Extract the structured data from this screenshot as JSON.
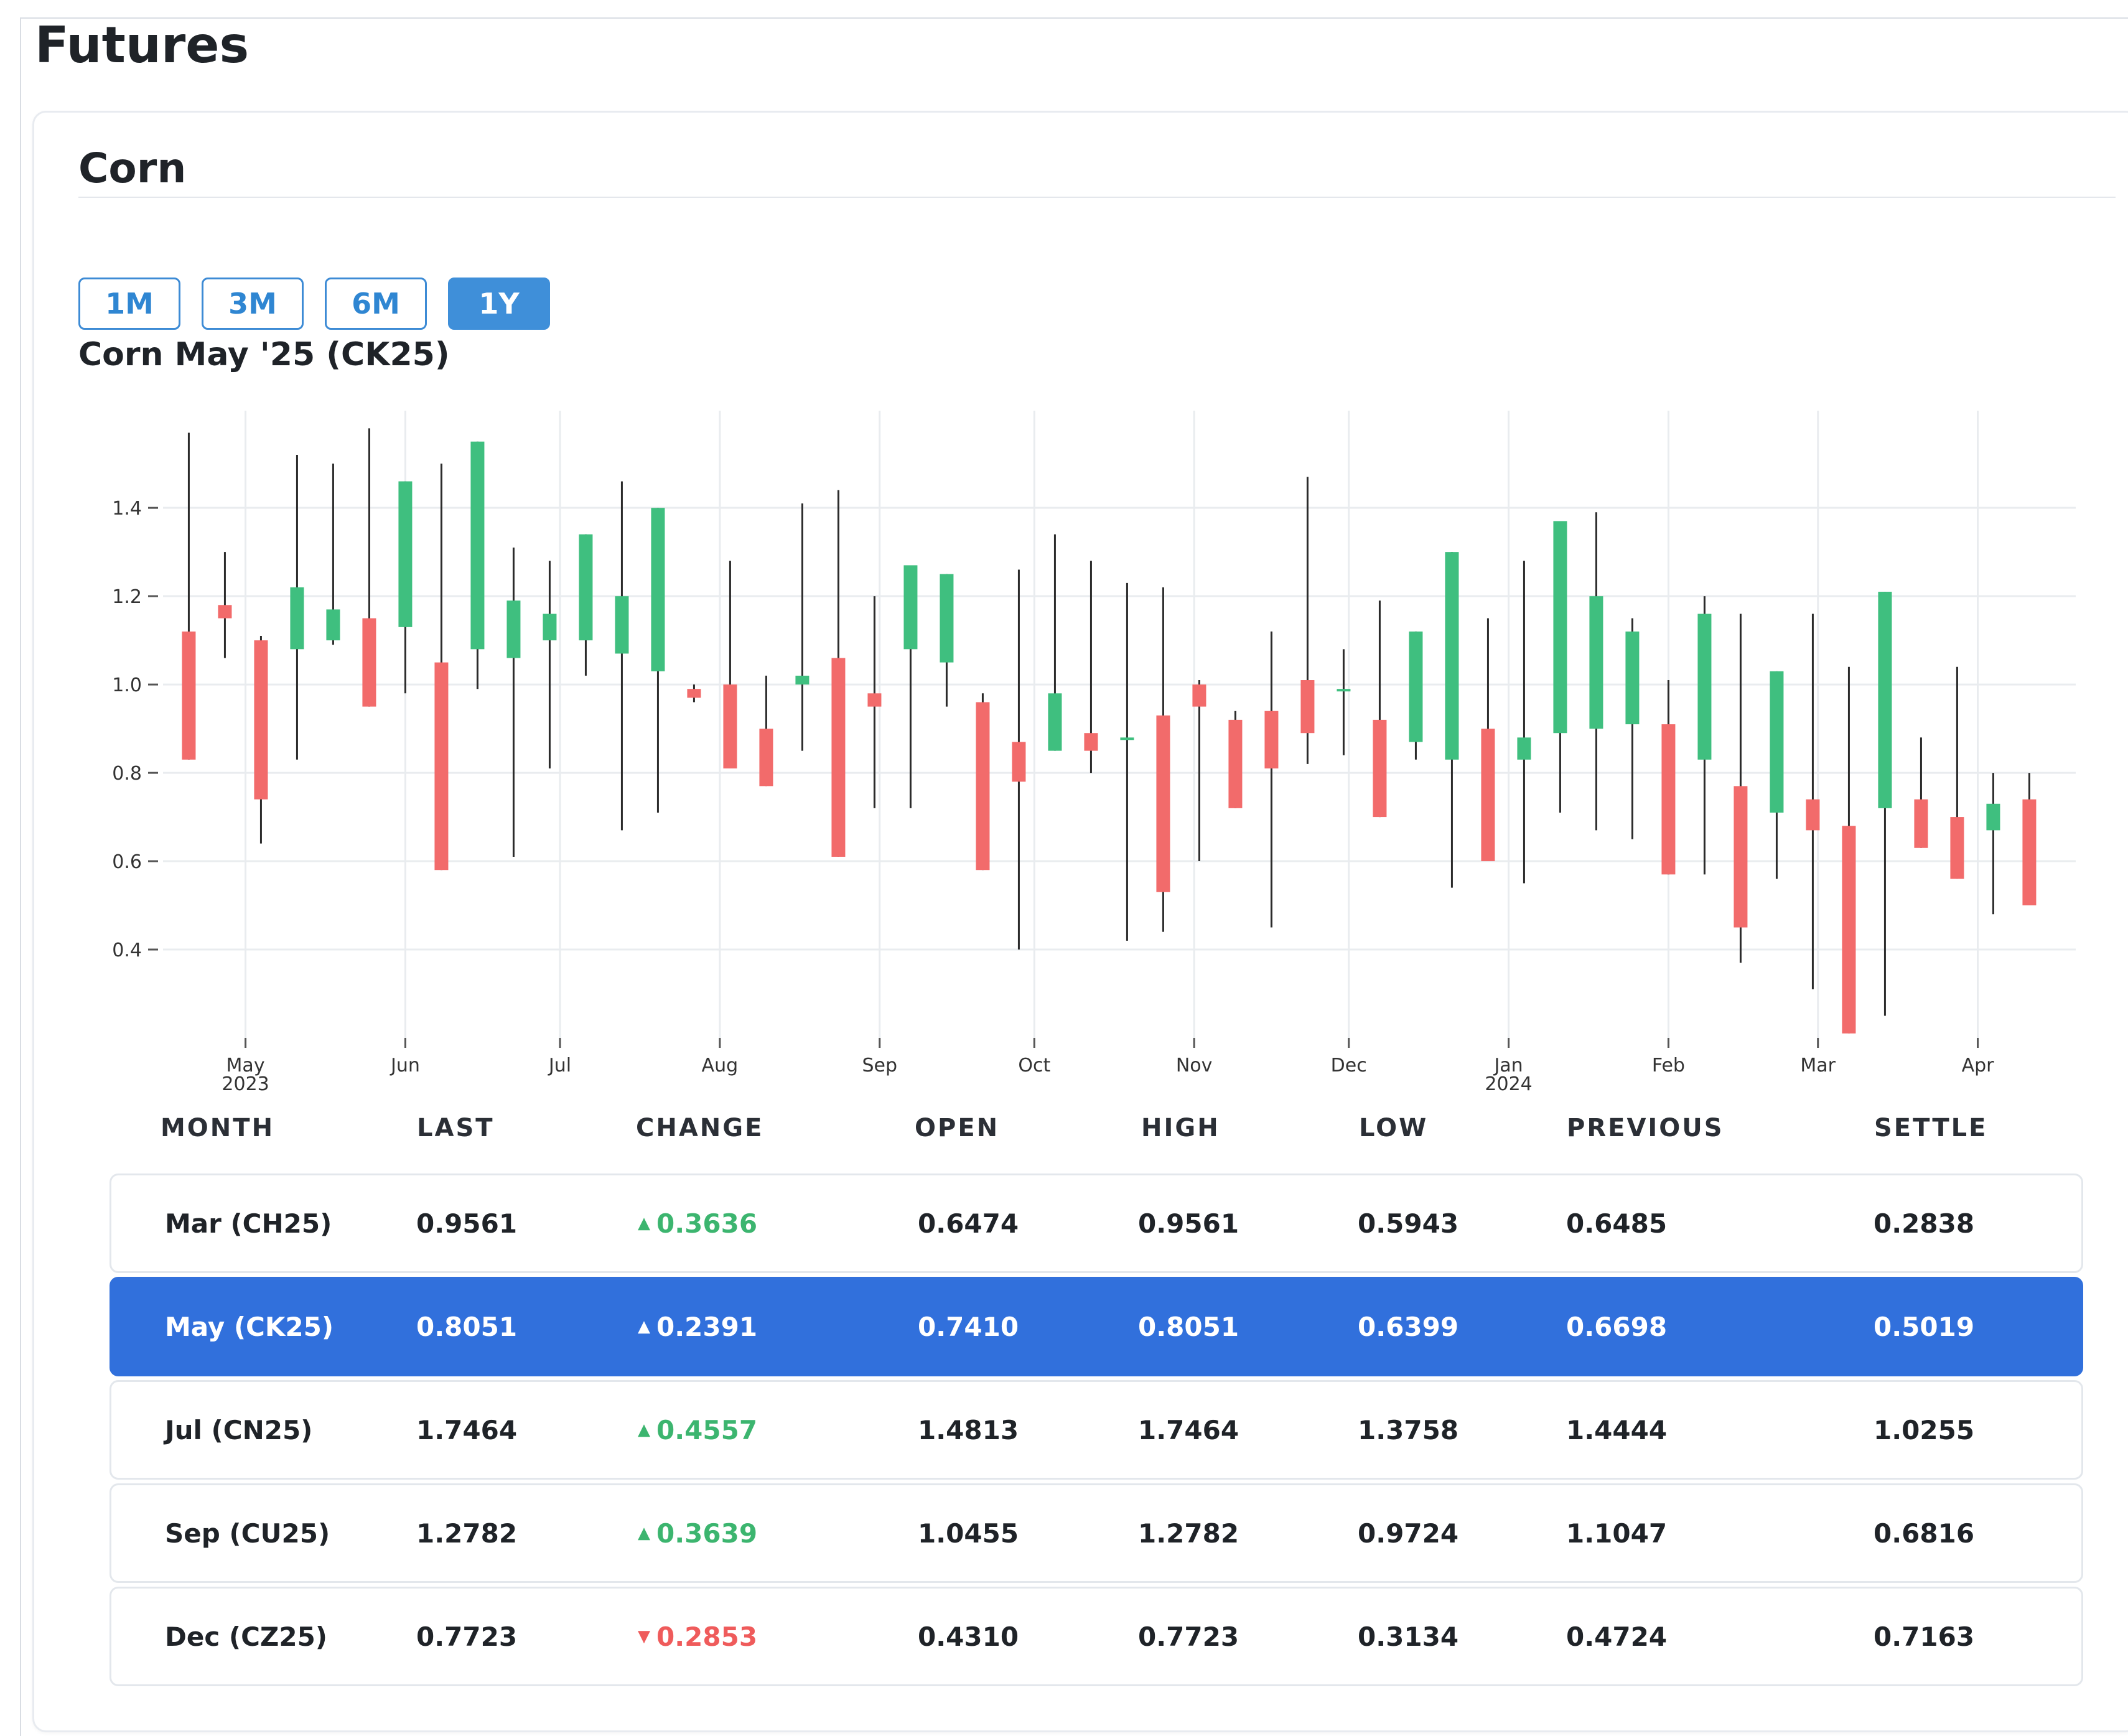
{
  "page_title": "Futures",
  "card": {
    "title": "Corn",
    "ranges": [
      {
        "label": "1M",
        "active": false
      },
      {
        "label": "3M",
        "active": false
      },
      {
        "label": "6M",
        "active": false
      },
      {
        "label": "1Y",
        "active": true
      }
    ],
    "chart_title": "Corn May '25 (CK25)"
  },
  "colors": {
    "up": "#3fbf7f",
    "down": "#f26b6b",
    "wick": "#2b2b2b",
    "grid": "#e9ecef",
    "selected_row": "#3170dc",
    "accent": "#3f8fd9"
  },
  "chart_data": {
    "type": "candlestick",
    "ylim": [
      0.2,
      1.62
    ],
    "yticks": [
      "0.4",
      "0.6",
      "0.8",
      "1.0",
      "1.2",
      "1.4"
    ],
    "x_range": [
      "2023-04-15",
      "2024-04-20"
    ],
    "xticks": [
      {
        "date": "2023-05-01",
        "label": "May",
        "sub": "2023"
      },
      {
        "date": "2023-06-01",
        "label": "Jun",
        "sub": ""
      },
      {
        "date": "2023-07-01",
        "label": "Jul",
        "sub": ""
      },
      {
        "date": "2023-08-01",
        "label": "Aug",
        "sub": ""
      },
      {
        "date": "2023-09-01",
        "label": "Sep",
        "sub": ""
      },
      {
        "date": "2023-10-01",
        "label": "Oct",
        "sub": ""
      },
      {
        "date": "2023-11-01",
        "label": "Nov",
        "sub": ""
      },
      {
        "date": "2023-12-01",
        "label": "Dec",
        "sub": ""
      },
      {
        "date": "2024-01-01",
        "label": "Jan",
        "sub": "2024"
      },
      {
        "date": "2024-02-01",
        "label": "Feb",
        "sub": ""
      },
      {
        "date": "2024-03-01",
        "label": "Mar",
        "sub": ""
      },
      {
        "date": "2024-04-01",
        "label": "Apr",
        "sub": ""
      }
    ],
    "candles": [
      {
        "date": "2023-04-20",
        "open": 1.12,
        "high": 1.57,
        "low": 0.83,
        "close": 0.83
      },
      {
        "date": "2023-04-27",
        "open": 1.18,
        "high": 1.3,
        "low": 1.06,
        "close": 1.15
      },
      {
        "date": "2023-05-04",
        "open": 1.1,
        "high": 1.11,
        "low": 0.64,
        "close": 0.74
      },
      {
        "date": "2023-05-11",
        "open": 1.08,
        "high": 1.52,
        "low": 0.83,
        "close": 1.22
      },
      {
        "date": "2023-05-18",
        "open": 1.1,
        "high": 1.5,
        "low": 1.09,
        "close": 1.17
      },
      {
        "date": "2023-05-25",
        "open": 1.15,
        "high": 1.58,
        "low": 0.95,
        "close": 0.95
      },
      {
        "date": "2023-06-01",
        "open": 1.13,
        "high": 1.46,
        "low": 0.98,
        "close": 1.46
      },
      {
        "date": "2023-06-08",
        "open": 1.05,
        "high": 1.5,
        "low": 0.58,
        "close": 0.58
      },
      {
        "date": "2023-06-15",
        "open": 1.08,
        "high": 1.55,
        "low": 0.99,
        "close": 1.55
      },
      {
        "date": "2023-06-22",
        "open": 1.06,
        "high": 1.31,
        "low": 0.61,
        "close": 1.19
      },
      {
        "date": "2023-06-29",
        "open": 1.1,
        "high": 1.28,
        "low": 0.81,
        "close": 1.16
      },
      {
        "date": "2023-07-06",
        "open": 1.1,
        "high": 1.34,
        "low": 1.02,
        "close": 1.34
      },
      {
        "date": "2023-07-13",
        "open": 1.07,
        "high": 1.46,
        "low": 0.67,
        "close": 1.2
      },
      {
        "date": "2023-07-20",
        "open": 1.03,
        "high": 1.4,
        "low": 0.71,
        "close": 1.4
      },
      {
        "date": "2023-07-27",
        "open": 0.99,
        "high": 1.0,
        "low": 0.96,
        "close": 0.97
      },
      {
        "date": "2023-08-03",
        "open": 1.0,
        "high": 1.28,
        "low": 0.81,
        "close": 0.81
      },
      {
        "date": "2023-08-10",
        "open": 0.9,
        "high": 1.02,
        "low": 0.77,
        "close": 0.77
      },
      {
        "date": "2023-08-17",
        "open": 1.0,
        "high": 1.41,
        "low": 0.85,
        "close": 1.02
      },
      {
        "date": "2023-08-24",
        "open": 1.06,
        "high": 1.44,
        "low": 0.61,
        "close": 0.61
      },
      {
        "date": "2023-08-31",
        "open": 0.98,
        "high": 1.2,
        "low": 0.72,
        "close": 0.95
      },
      {
        "date": "2023-09-07",
        "open": 1.08,
        "high": 1.27,
        "low": 0.72,
        "close": 1.27
      },
      {
        "date": "2023-09-14",
        "open": 1.05,
        "high": 1.25,
        "low": 0.95,
        "close": 1.25
      },
      {
        "date": "2023-09-21",
        "open": 0.96,
        "high": 0.98,
        "low": 0.58,
        "close": 0.58
      },
      {
        "date": "2023-09-28",
        "open": 0.87,
        "high": 1.26,
        "low": 0.4,
        "close": 0.78
      },
      {
        "date": "2023-10-05",
        "open": 0.85,
        "high": 1.34,
        "low": 0.85,
        "close": 0.98
      },
      {
        "date": "2023-10-12",
        "open": 0.89,
        "high": 1.28,
        "low": 0.8,
        "close": 0.85
      },
      {
        "date": "2023-10-19",
        "open": 0.88,
        "high": 1.23,
        "low": 0.42,
        "close": 0.88
      },
      {
        "date": "2023-10-26",
        "open": 0.93,
        "high": 1.22,
        "low": 0.44,
        "close": 0.53
      },
      {
        "date": "2023-11-02",
        "open": 1.0,
        "high": 1.01,
        "low": 0.6,
        "close": 0.95
      },
      {
        "date": "2023-11-09",
        "open": 0.92,
        "high": 0.94,
        "low": 0.72,
        "close": 0.72
      },
      {
        "date": "2023-11-16",
        "open": 0.94,
        "high": 1.12,
        "low": 0.45,
        "close": 0.81
      },
      {
        "date": "2023-11-23",
        "open": 1.01,
        "high": 1.47,
        "low": 0.82,
        "close": 0.89
      },
      {
        "date": "2023-11-30",
        "open": 0.99,
        "high": 1.08,
        "low": 0.84,
        "close": 0.99
      },
      {
        "date": "2023-12-07",
        "open": 0.92,
        "high": 1.19,
        "low": 0.7,
        "close": 0.7
      },
      {
        "date": "2023-12-14",
        "open": 0.87,
        "high": 1.12,
        "low": 0.83,
        "close": 1.12
      },
      {
        "date": "2023-12-21",
        "open": 0.83,
        "high": 1.3,
        "low": 0.54,
        "close": 1.3
      },
      {
        "date": "2023-12-28",
        "open": 0.9,
        "high": 1.15,
        "low": 0.6,
        "close": 0.6
      },
      {
        "date": "2024-01-04",
        "open": 0.83,
        "high": 1.28,
        "low": 0.55,
        "close": 0.88
      },
      {
        "date": "2024-01-11",
        "open": 0.89,
        "high": 1.37,
        "low": 0.71,
        "close": 1.37
      },
      {
        "date": "2024-01-18",
        "open": 0.9,
        "high": 1.39,
        "low": 0.67,
        "close": 1.2
      },
      {
        "date": "2024-01-25",
        "open": 0.91,
        "high": 1.15,
        "low": 0.65,
        "close": 1.12
      },
      {
        "date": "2024-02-01",
        "open": 0.91,
        "high": 1.01,
        "low": 0.57,
        "close": 0.57
      },
      {
        "date": "2024-02-08",
        "open": 0.83,
        "high": 1.2,
        "low": 0.57,
        "close": 1.16
      },
      {
        "date": "2024-02-15",
        "open": 0.77,
        "high": 1.16,
        "low": 0.37,
        "close": 0.45
      },
      {
        "date": "2024-02-22",
        "open": 0.71,
        "high": 1.03,
        "low": 0.56,
        "close": 1.03
      },
      {
        "date": "2024-02-29",
        "open": 0.74,
        "high": 1.16,
        "low": 0.31,
        "close": 0.67
      },
      {
        "date": "2024-03-07",
        "open": 0.68,
        "high": 1.04,
        "low": 0.21,
        "close": 0.21
      },
      {
        "date": "2024-03-14",
        "open": 0.72,
        "high": 1.21,
        "low": 0.25,
        "close": 1.21
      },
      {
        "date": "2024-03-21",
        "open": 0.74,
        "high": 0.88,
        "low": 0.63,
        "close": 0.63
      },
      {
        "date": "2024-03-28",
        "open": 0.7,
        "high": 1.04,
        "low": 0.56,
        "close": 0.56
      },
      {
        "date": "2024-04-04",
        "open": 0.67,
        "high": 0.8,
        "low": 0.48,
        "close": 0.73
      },
      {
        "date": "2024-04-11",
        "open": 0.74,
        "high": 0.8,
        "low": 0.5,
        "close": 0.5
      }
    ]
  },
  "table": {
    "headers": {
      "month": "MONTH",
      "last": "LAST",
      "change": "CHANGE",
      "open": "OPEN",
      "high": "HIGH",
      "low": "LOW",
      "previous": "PREVIOUS",
      "settle": "SETTLE"
    },
    "rows": [
      {
        "month": "Mar (CH25)",
        "last": "0.9561",
        "change": "0.3636",
        "direction": "up",
        "arrow": "▲",
        "open": "0.6474",
        "high": "0.9561",
        "low": "0.5943",
        "previous": "0.6485",
        "settle": "0.2838",
        "selected": false
      },
      {
        "month": "May (CK25)",
        "last": "0.8051",
        "change": "0.2391",
        "direction": "up",
        "arrow": "▲",
        "open": "0.7410",
        "high": "0.8051",
        "low": "0.6399",
        "previous": "0.6698",
        "settle": "0.5019",
        "selected": true
      },
      {
        "month": "Jul (CN25)",
        "last": "1.7464",
        "change": "0.4557",
        "direction": "up",
        "arrow": "▲",
        "open": "1.4813",
        "high": "1.7464",
        "low": "1.3758",
        "previous": "1.4444",
        "settle": "1.0255",
        "selected": false
      },
      {
        "month": "Sep (CU25)",
        "last": "1.2782",
        "change": "0.3639",
        "direction": "up",
        "arrow": "▲",
        "open": "1.0455",
        "high": "1.2782",
        "low": "0.9724",
        "previous": "1.1047",
        "settle": "0.6816",
        "selected": false
      },
      {
        "month": "Dec (CZ25)",
        "last": "0.7723",
        "change": "0.2853",
        "direction": "down",
        "arrow": "▼",
        "open": "0.4310",
        "high": "0.7723",
        "low": "0.3134",
        "previous": "0.4724",
        "settle": "0.7163",
        "selected": false
      }
    ]
  }
}
